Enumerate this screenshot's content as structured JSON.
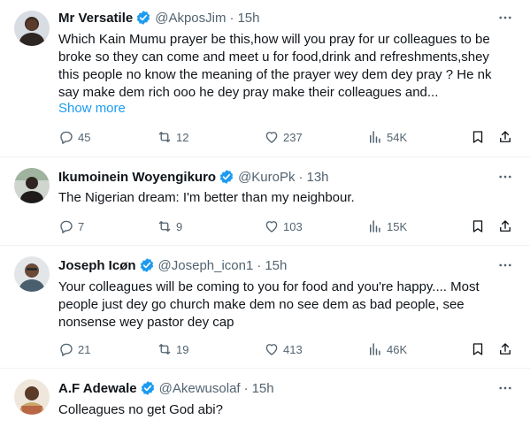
{
  "tweets": [
    {
      "name": "Mr Versatile",
      "handle": "@AkposJim",
      "time": "15h",
      "lines": [
        "Which Kain Mumu prayer be this,how will you pray for ur colleagues to be",
        "broke so they can come and meet u for food,drink and refreshments,shey",
        "this people no know the meaning of the prayer wey dem dey pray ? He nk",
        "say make dem rich ooo he dey pray make their colleagues and..."
      ],
      "show_more": "Show more",
      "replies": "45",
      "reposts": "12",
      "likes": "237",
      "views": "54K"
    },
    {
      "name": "Ikumoinein Woyengikuro",
      "handle": "@KuroPk",
      "time": "13h",
      "lines": [
        "The Nigerian dream: I'm better than my neighbour."
      ],
      "replies": "7",
      "reposts": "9",
      "likes": "103",
      "views": "15K"
    },
    {
      "name": "Joseph Icøn",
      "handle": "@Joseph_icon1",
      "time": "15h",
      "lines": [
        "Your colleagues will be coming to you for food and you're happy.... Most",
        "people just dey go church make dem no see dem as bad people, see",
        "nonsense wey pastor dey cap"
      ],
      "replies": "21",
      "reposts": "19",
      "likes": "413",
      "views": "46K"
    },
    {
      "name": "A.F Adewale",
      "handle": "@Akewusolaf",
      "time": "15h",
      "lines": [
        "Colleagues no get God abi?"
      ]
    }
  ],
  "separator": "·",
  "icons": {
    "reply": "reply-icon",
    "repost": "repost-icon",
    "like": "heart-icon",
    "views": "views-icon",
    "bookmark": "bookmark-icon",
    "share": "share-icon",
    "more": "more-icon",
    "verified": "verified-badge-icon"
  },
  "colors": {
    "text": "#0f1419",
    "muted": "#536471",
    "link": "#1d9bf0",
    "verified": "#1d9bf0",
    "divider": "#eff3f4"
  }
}
